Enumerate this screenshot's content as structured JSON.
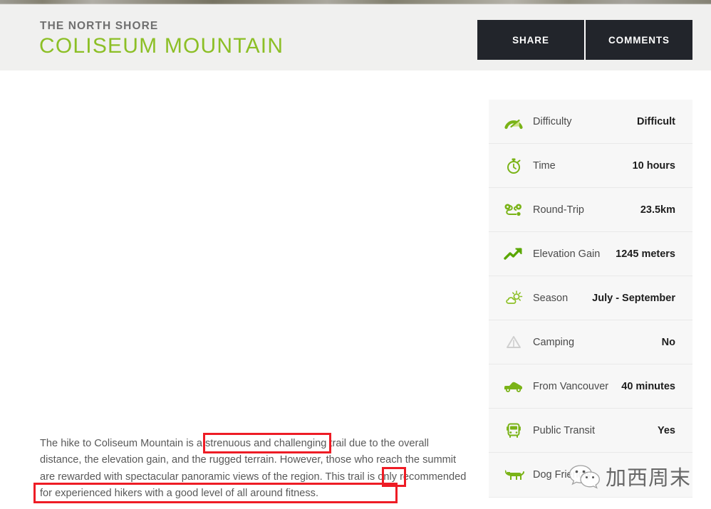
{
  "header": {
    "eyebrow": "THE NORTH SHORE",
    "title": "COLISEUM MOUNTAIN",
    "accent_color": "#8cbf26",
    "band_color": "#f0f0ef",
    "buttons": [
      {
        "label": "SHARE",
        "name": "share-button"
      },
      {
        "label": "COMMENTS",
        "name": "comments-button"
      }
    ]
  },
  "info_panel": {
    "rows": [
      {
        "icon": "speedometer-icon",
        "label": "Difficulty",
        "value": "Difficult",
        "icon_color": "#7ab317"
      },
      {
        "icon": "stopwatch-icon",
        "label": "Time",
        "value": "10 hours",
        "icon_color": "#7ab317"
      },
      {
        "icon": "route-icon",
        "label": "Round-Trip",
        "value": "23.5km",
        "icon_color": "#7ab317"
      },
      {
        "icon": "trending-up-icon",
        "label": "Elevation Gain",
        "value": "1245 meters",
        "icon_color": "#5aa702"
      },
      {
        "icon": "sun-cloud-icon",
        "label": "Season",
        "value": "July - September",
        "icon_color": "#8cbf26"
      },
      {
        "icon": "tent-icon",
        "label": "Camping",
        "value": "No",
        "icon_color": "#cfcfcf"
      },
      {
        "icon": "car-icon",
        "label": "From Vancouver",
        "value": "40 minutes",
        "icon_color": "#7ab317"
      },
      {
        "icon": "bus-icon",
        "label": "Public Transit",
        "value": "Yes",
        "icon_color": "#7ab317"
      },
      {
        "icon": "dog-icon",
        "label": "Dog Friendly",
        "value": "",
        "icon_color": "#7ab317"
      }
    ]
  },
  "body": {
    "paragraph": "The hike to Coliseum Mountain is a strenuous and challenging trail due to the overall distance, the elevation gain, and the rugged terrain. However, those who reach the summit are rewarded with spectacular panoramic views of the region. This trail is only recommended for experienced hikers with a good level of all around fitness."
  },
  "annotations": {
    "color": "#ee1c25",
    "highlights": [
      "strenuous and challenging",
      "only",
      "recommended for experienced hikers with a good level of all around fitness."
    ]
  },
  "watermark": {
    "text": "加西周末",
    "logo": "wechat-icon"
  }
}
